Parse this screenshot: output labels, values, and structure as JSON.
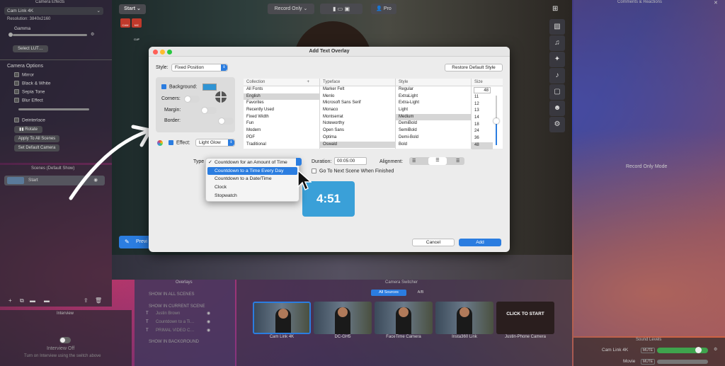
{
  "left_panel": {
    "header": "Camera Effects",
    "camera_select": "Cam Link 4K",
    "resolution": "Resolution: 3840x2160",
    "gamma_label": "Gamma",
    "select_lut": "Select LUT…",
    "camera_options_header": "Camera Options",
    "options": [
      "Mirror",
      "Black & White",
      "Sepia Tone",
      "Blur Effect"
    ],
    "deinterlace": "Deinterlace",
    "rotate": "Rotate",
    "apply_all": "Apply To All Scenes",
    "set_default": "Set Default Camera"
  },
  "scenes": {
    "header": "Scenes (Default Show)",
    "items": [
      "Start"
    ]
  },
  "interview": {
    "header": "Interview",
    "status": "Interview Off",
    "hint": "Turn on Interview using the switch above"
  },
  "top_bar": {
    "scene_button": "Start",
    "record_mode": "Record Only",
    "pro_label": "Pro",
    "rec_badge_1": "CAM",
    "rec_badge_2": "MIC CLIP"
  },
  "right_panel": {
    "header": "Comments & Reactions",
    "mode": "Record Only Mode"
  },
  "dialog": {
    "title": "Add Text Overlay",
    "style_label": "Style:",
    "style_value": "Fixed Position",
    "restore_button": "Restore Default Style",
    "background_label": "Background:",
    "corners_label": "Corners:",
    "margin_label": "Margin:",
    "border_label": "Border:",
    "effect_label": "Effect:",
    "effect_value": "Light Glow",
    "collection_header": "Collection",
    "collections": [
      "All Fonts",
      "English",
      "Favorites",
      "Recently Used",
      "Fixed Width",
      "Fun",
      "Modern",
      "PDF",
      "Traditional"
    ],
    "typeface_header": "Typeface",
    "typefaces": [
      "Marker Felt",
      "Menlo",
      "Microsoft Sans Serif",
      "Monaco",
      "Montserrat",
      "Noteworthy",
      "Open Sans",
      "Optima",
      "Oswald"
    ],
    "style_header": "Style",
    "styles": [
      "Regular",
      "ExtraLight",
      "Extra-Light",
      "Light",
      "Medium",
      "DemiBold",
      "SemiBold",
      "Demi-Bold",
      "Bold"
    ],
    "size_header": "Size",
    "size_value": "48",
    "sizes": [
      "11",
      "12",
      "13",
      "14",
      "18",
      "24",
      "36",
      "48"
    ],
    "type_label": "Type",
    "duration_label": "Duration:",
    "duration_value": "00:05:00",
    "alignment_label": "Alignment:",
    "next_scene_label": "Go To Next Scene When Finished",
    "countdown_preview": "4:51",
    "cancel_button": "Cancel",
    "add_button": "Add"
  },
  "type_menu": {
    "items": [
      "Countdown for an Amount of Time",
      "Countdown to a Time Every Day",
      "Countdown to a Date/Time",
      "Clock",
      "Stopwatch"
    ],
    "checked": "Countdown for an Amount of Time",
    "highlighted": "Countdown to a Time Every Day"
  },
  "preview_button": "Previ",
  "overlays": {
    "header": "Overlays",
    "show_all": "SHOW IN ALL SCENES",
    "show_current": "SHOW IN CURRENT SCENE",
    "items": [
      "Justin Brown",
      "Countdown to a Ti…",
      "PRIMAL VIDEO C…"
    ],
    "show_background": "SHOW IN BACKGROUND"
  },
  "switcher": {
    "header": "Camera Switcher",
    "tab_all": "All Sources",
    "tab_ab": "A/B",
    "cameras": [
      "Cam Link 4K",
      "DC-GH5",
      "FaceTime Camera",
      "Insta360 Link",
      "Justin-Phone Camera"
    ],
    "click_to_start": "CLICK TO START"
  },
  "sound": {
    "header": "Sound Levels",
    "sources": [
      "Cam Link 4K",
      "Movie"
    ],
    "mute_label": "MUTE"
  }
}
